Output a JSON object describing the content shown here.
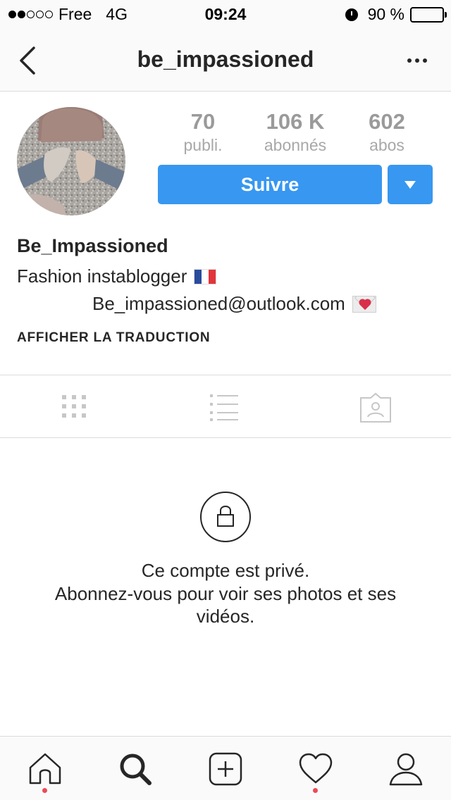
{
  "status_bar": {
    "carrier": "Free",
    "network": "4G",
    "time": "09:24",
    "battery": "90 %",
    "battery_level": 0.9,
    "signal_bars_filled": 2,
    "signal_bars_total": 5
  },
  "nav": {
    "title": "be_impassioned",
    "back_icon": "chevron-left-icon",
    "more_icon": "more-horizontal-icon"
  },
  "profile": {
    "stats": [
      {
        "value": "70",
        "label": "publi."
      },
      {
        "value": "106 K",
        "label": "abonnés"
      },
      {
        "value": "602",
        "label": "abos"
      }
    ],
    "follow_label": "Suivre",
    "name": "Be_Impassioned",
    "bio_line1": "Fashion instablogger",
    "bio_line2": "Be_impassioned@outlook.com",
    "translate_label": "AFFICHER LA TRADUCTION"
  },
  "tabs": [
    "grid-icon",
    "list-icon",
    "tagged-icon"
  ],
  "private": {
    "title": "Ce compte est privé.",
    "description": "Abonnez-vous pour voir ses photos et ses vidéos."
  },
  "bottom_nav": [
    "home-icon",
    "search-icon",
    "add-icon",
    "heart-icon",
    "profile-icon"
  ],
  "colors": {
    "accent": "#3897f0",
    "notification": "#ed4956",
    "text": "#262626",
    "muted": "#9a9a9a"
  }
}
